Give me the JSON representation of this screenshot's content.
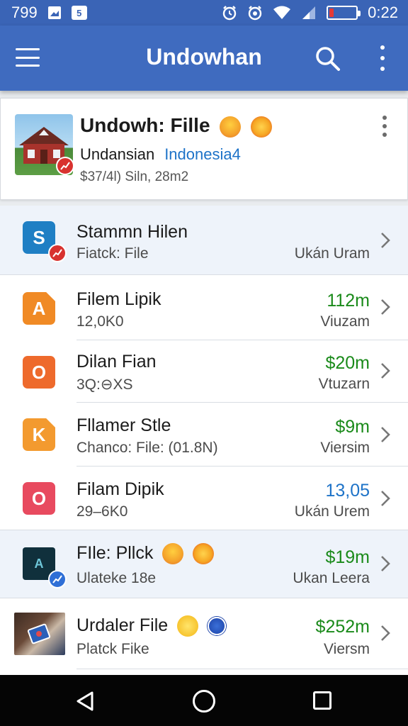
{
  "status_bar": {
    "left_number": "799",
    "left_box": "5",
    "time": "0:22",
    "battery_level": 0.15,
    "icons": [
      "image-icon",
      "sim-icon",
      "alarm-icon",
      "alarm-clock-icon",
      "wifi-icon",
      "signal-icon",
      "battery-icon"
    ]
  },
  "app_bar": {
    "title": "Undowhan",
    "icons": [
      "menu-icon",
      "search-icon",
      "more-vert-icon"
    ]
  },
  "featured": {
    "title": "Undowh: Fille",
    "subtitle": "Undansian",
    "location": "Indonesia4",
    "meta": "$37/4l) Siln, 28m2",
    "image": "house-thumbnail",
    "badge": "trend-icon"
  },
  "list": [
    {
      "title": "Stammn Hilen",
      "subtitle": "Fiatck: File",
      "amount": "",
      "right": "Ukán Uram",
      "icon": "sheets-icon",
      "icon_letter": "S",
      "amount_color": "",
      "highlight": true
    },
    {
      "title": "Filem Lipik",
      "subtitle": "12,0K0",
      "amount": "112m",
      "right": "Viuzam",
      "icon": "doc-orange-icon",
      "icon_letter": "A",
      "amount_color": "green",
      "highlight": false
    },
    {
      "title": "Dilan Fian",
      "subtitle": "3Q:⊖XS",
      "amount": "$20m",
      "right": "Vtuzarn",
      "icon": "office-icon",
      "icon_letter": "O",
      "amount_color": "green",
      "highlight": false
    },
    {
      "title": "Fllamer Stle",
      "subtitle": "Chanco: File: (01.8N)",
      "amount": "$9m",
      "right": "Viersim",
      "icon": "doc-collapse-icon",
      "icon_letter": "K",
      "amount_color": "green",
      "highlight": false
    },
    {
      "title": "Filam Dipik",
      "subtitle": "29–6K0",
      "amount": "13,05",
      "right": "Ukán Urem",
      "icon": "office-red-icon",
      "icon_letter": "O",
      "amount_color": "blue",
      "highlight": false
    },
    {
      "title": "FIle: Pllck",
      "subtitle": "Ulateke 18e",
      "amount": "$19m",
      "right": "Ukan Leera",
      "icon": "box-file-icon",
      "icon_letter": "A",
      "amount_color": "green",
      "highlight": true
    },
    {
      "title": "Urdaler File",
      "subtitle": "Platck Fike",
      "amount": "$252m",
      "right": "Viersm",
      "icon": "photo-thumbnail",
      "icon_letter": "",
      "amount_color": "green",
      "highlight": false
    }
  ],
  "nav_bar": {
    "icons": [
      "back-icon",
      "home-icon",
      "recents-icon"
    ]
  },
  "colors": {
    "primary": "#3f6bbf",
    "status_bar": "#3a64b6",
    "amount_green": "#1a8a1a",
    "amount_blue": "#1e73c8",
    "badge_red": "#d8322f"
  }
}
